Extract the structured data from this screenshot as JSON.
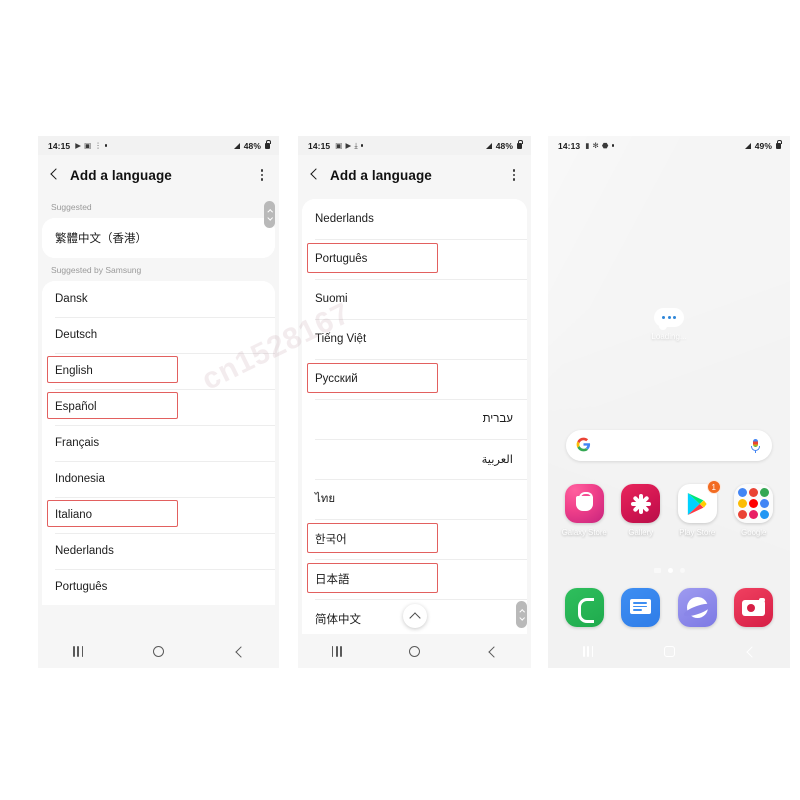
{
  "watermark": "cn1528167",
  "phone1": {
    "status": {
      "clock": "14:15",
      "icons": [
        "play-icon",
        "image-icon",
        "more-icon",
        "dot-icon"
      ],
      "battery": "48%",
      "signal": "signal-icon",
      "lock": "lock-icon"
    },
    "appbar": {
      "title": "Add a language",
      "back": "back-icon",
      "menu": "more-options-icon"
    },
    "sections": [
      {
        "header": "Suggested",
        "items": [
          {
            "label": "繁體中文（香港）",
            "highlight": false
          }
        ]
      },
      {
        "header": "Suggested by Samsung",
        "items": [
          {
            "label": "Dansk",
            "highlight": false
          },
          {
            "label": "Deutsch",
            "highlight": false
          },
          {
            "label": "English",
            "highlight": true
          },
          {
            "label": "Español",
            "highlight": true
          },
          {
            "label": "Français",
            "highlight": false
          },
          {
            "label": "Indonesia",
            "highlight": false
          },
          {
            "label": "Italiano",
            "highlight": true
          },
          {
            "label": "Nederlands",
            "highlight": false
          },
          {
            "label": "Português",
            "highlight": false
          }
        ]
      }
    ],
    "nav": {
      "recent": "recents-icon",
      "home": "home-icon",
      "back": "back-icon"
    }
  },
  "phone2": {
    "status": {
      "clock": "14:15",
      "icons": [
        "image-icon",
        "play-icon",
        "download-icon",
        "dot-icon"
      ],
      "battery": "48%",
      "signal": "signal-icon",
      "lock": "lock-icon"
    },
    "appbar": {
      "title": "Add a language",
      "back": "back-icon",
      "menu": "more-options-icon"
    },
    "items": [
      {
        "label": "Nederlands",
        "highlight": false,
        "rtl": false
      },
      {
        "label": "Português",
        "highlight": true,
        "rtl": false
      },
      {
        "label": "Suomi",
        "highlight": false,
        "rtl": false
      },
      {
        "label": "Tiếng Việt",
        "highlight": false,
        "rtl": false
      },
      {
        "label": "Русский",
        "highlight": true,
        "rtl": false
      },
      {
        "label": "עברית",
        "highlight": false,
        "rtl": true
      },
      {
        "label": "العربية",
        "highlight": false,
        "rtl": true
      },
      {
        "label": "ไทย",
        "highlight": false,
        "rtl": false
      },
      {
        "label": "한국어",
        "highlight": true,
        "rtl": false
      },
      {
        "label": "日本語",
        "highlight": true,
        "rtl": false
      },
      {
        "label": "简体中文",
        "highlight": false,
        "rtl": false
      }
    ],
    "scroll_up_fab": "scroll-to-top-icon",
    "nav": {
      "recent": "recents-icon",
      "home": "home-icon",
      "back": "back-icon"
    }
  },
  "phone3": {
    "status": {
      "clock": "14:13",
      "icons": [
        "sim-icon",
        "settings-icon",
        "shield-icon",
        "dot-icon"
      ],
      "battery": "49%",
      "signal": "signal-icon",
      "lock": "lock-icon"
    },
    "widget": {
      "text": "Loading...",
      "icon": "chat-bubble-icon"
    },
    "search": {
      "logo": "google-g-icon",
      "mic": "microphone-icon"
    },
    "apps": [
      {
        "label": "Galaxy Store",
        "icon": "galaxy-store-icon",
        "badge": ""
      },
      {
        "label": "Gallery",
        "icon": "gallery-icon",
        "badge": ""
      },
      {
        "label": "Play Store",
        "icon": "play-store-icon",
        "badge": "1"
      },
      {
        "label": "Google",
        "icon": "google-folder-icon",
        "badge": ""
      }
    ],
    "page_dots": {
      "count": 3,
      "active_index": 1
    },
    "dock": [
      {
        "label": "Phone",
        "icon": "phone-icon"
      },
      {
        "label": "Messages",
        "icon": "messages-icon"
      },
      {
        "label": "Internet",
        "icon": "internet-icon"
      },
      {
        "label": "Camera",
        "icon": "camera-icon"
      }
    ],
    "nav": {
      "recent": "recents-icon",
      "home": "home-icon",
      "back": "back-icon"
    }
  },
  "colors": {
    "highlight_border": "#e2605f",
    "accent_badge": "#f26b21",
    "card_bg": "#ffffff",
    "screen_bg": "#f6f6f6"
  }
}
